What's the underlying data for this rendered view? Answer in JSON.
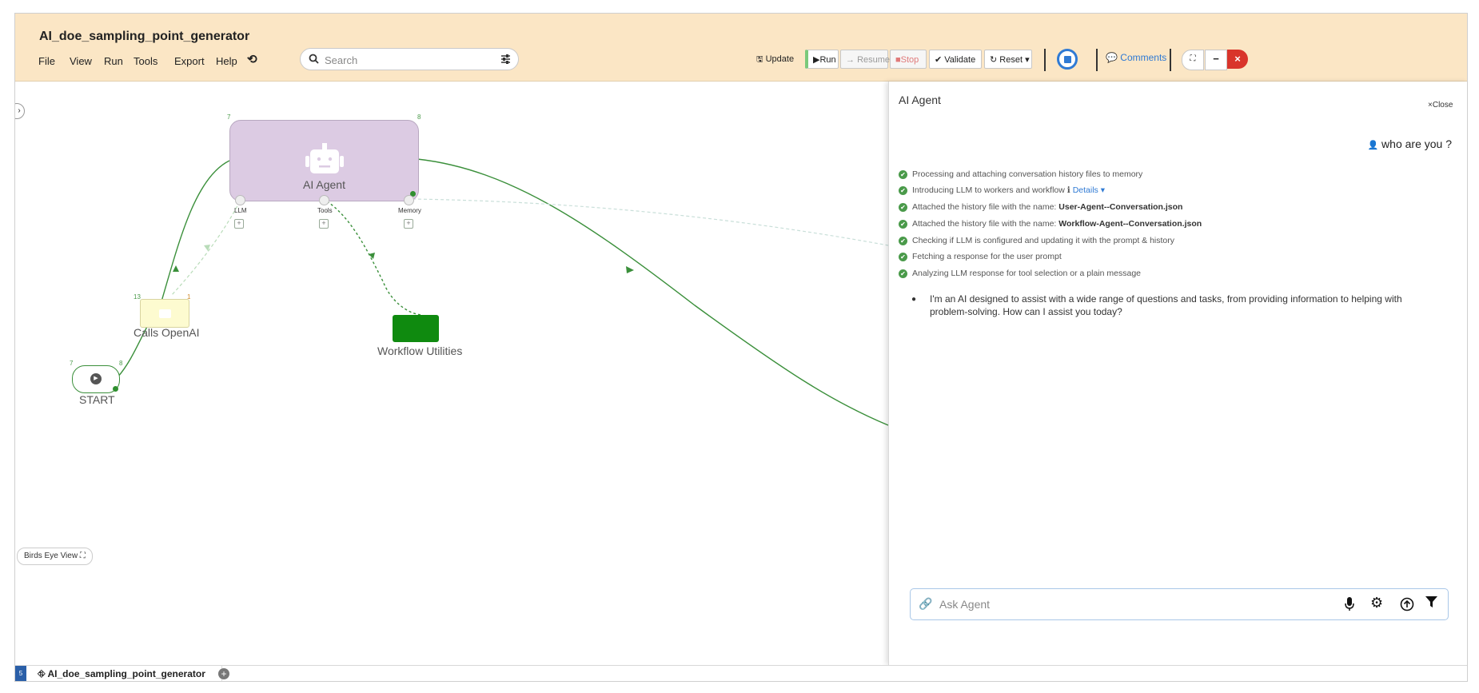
{
  "app": {
    "title": "AI_doe_sampling_point_generator"
  },
  "menu": [
    "File",
    "View",
    "Run",
    "Tools",
    "Export",
    "Help"
  ],
  "search": {
    "placeholder": "Search"
  },
  "toolbar": {
    "update_label": "Update",
    "run_label": "Run",
    "resume_label": "Resume",
    "stop_label": "Stop",
    "validate_label": "Validate",
    "reset_label": "Reset",
    "comments_label": "Comments"
  },
  "canvas": {
    "agent_node": {
      "label": "AI Agent",
      "in_count": "7",
      "out_count": "8",
      "ports": [
        "LLM",
        "Tools",
        "Memory"
      ]
    },
    "calls_node": {
      "label": "Calls OpenAI",
      "in_count": "13",
      "out_count": "1"
    },
    "utilities_node": {
      "label": "Workflow Utilities"
    },
    "start_node": {
      "label": "START",
      "in_count": "7",
      "out_count": "8"
    },
    "birds_eye_label": "Birds Eye View"
  },
  "agent_panel": {
    "title": "AI Agent",
    "close_label": "Close",
    "user_message": "who are you ?",
    "steps": [
      {
        "text": "Processing and attaching conversation history files to memory"
      },
      {
        "text": "Introducing LLM to workers and workflow",
        "link": "Details"
      },
      {
        "text": "Attached the history file with the name: ",
        "bold": "User-Agent--Conversation.json"
      },
      {
        "text": "Attached the history file with the name: ",
        "bold": "Workflow-Agent--Conversation.json"
      },
      {
        "text": "Checking if LLM is configured and updating it with the prompt & history"
      },
      {
        "text": "Fetching a response for the user prompt"
      },
      {
        "text": "Analyzing LLM response for tool selection or a plain message"
      }
    ],
    "response_line1": "I'm an AI designed to assist with a wide range of questions and tasks, from providing information to helping with",
    "response_line2": "problem-solving. How can I assist you today?",
    "input_placeholder": "Ask Agent"
  },
  "bottom": {
    "tab_label": "AI_doe_sampling_point_generator",
    "left_marker": "5"
  },
  "colors": {
    "topbar": "#fbe6c5",
    "agent_node": "#dccbe3",
    "accent_green": "#3a8f3a",
    "utilities_green": "#0f8a0f",
    "close_red": "#d9342b",
    "link_blue": "#2f7ad4"
  }
}
